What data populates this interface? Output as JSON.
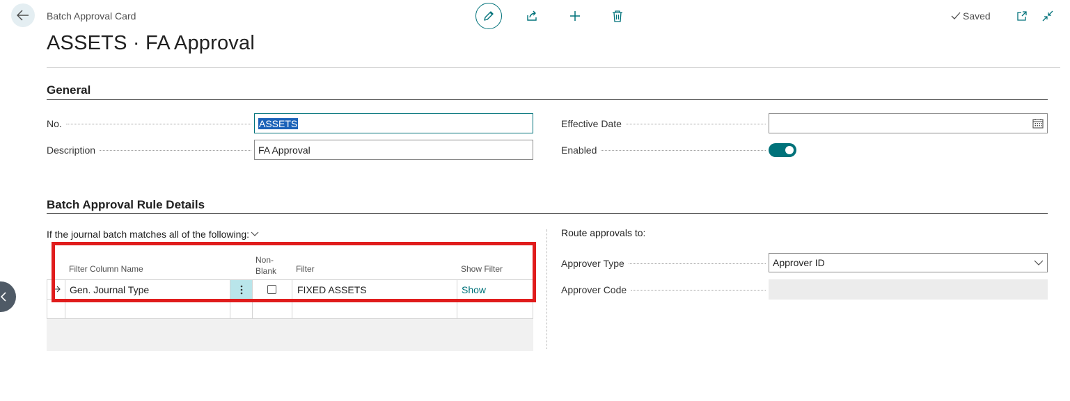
{
  "header": {
    "caption": "Batch Approval Card",
    "title": "ASSETS · FA Approval",
    "saved_status": "Saved"
  },
  "general": {
    "section_title": "General",
    "no_label": "No.",
    "no_value": "ASSETS",
    "description_label": "Description",
    "description_value": "FA Approval",
    "effective_date_label": "Effective Date",
    "effective_date_value": "",
    "enabled_label": "Enabled",
    "enabled": true
  },
  "rule_details": {
    "section_title": "Batch Approval Rule Details",
    "filter_caption": "If the journal batch matches all of the following:",
    "columns": {
      "filter_column_name": "Filter Column Name",
      "non_blank_line1": "Non-",
      "non_blank_line2": "Blank",
      "filter": "Filter",
      "show_filter": "Show Filter"
    },
    "rows": [
      {
        "filter_column_name": "Gen. Journal Type",
        "non_blank": false,
        "filter": "FIXED ASSETS",
        "show_filter": "Show"
      }
    ],
    "route_caption": "Route approvals to:",
    "approver_type_label": "Approver Type",
    "approver_type_value": "Approver ID",
    "approver_code_label": "Approver Code",
    "approver_code_value": ""
  },
  "theme": {
    "accent": "#00727a",
    "highlight": "#e01c1c"
  }
}
